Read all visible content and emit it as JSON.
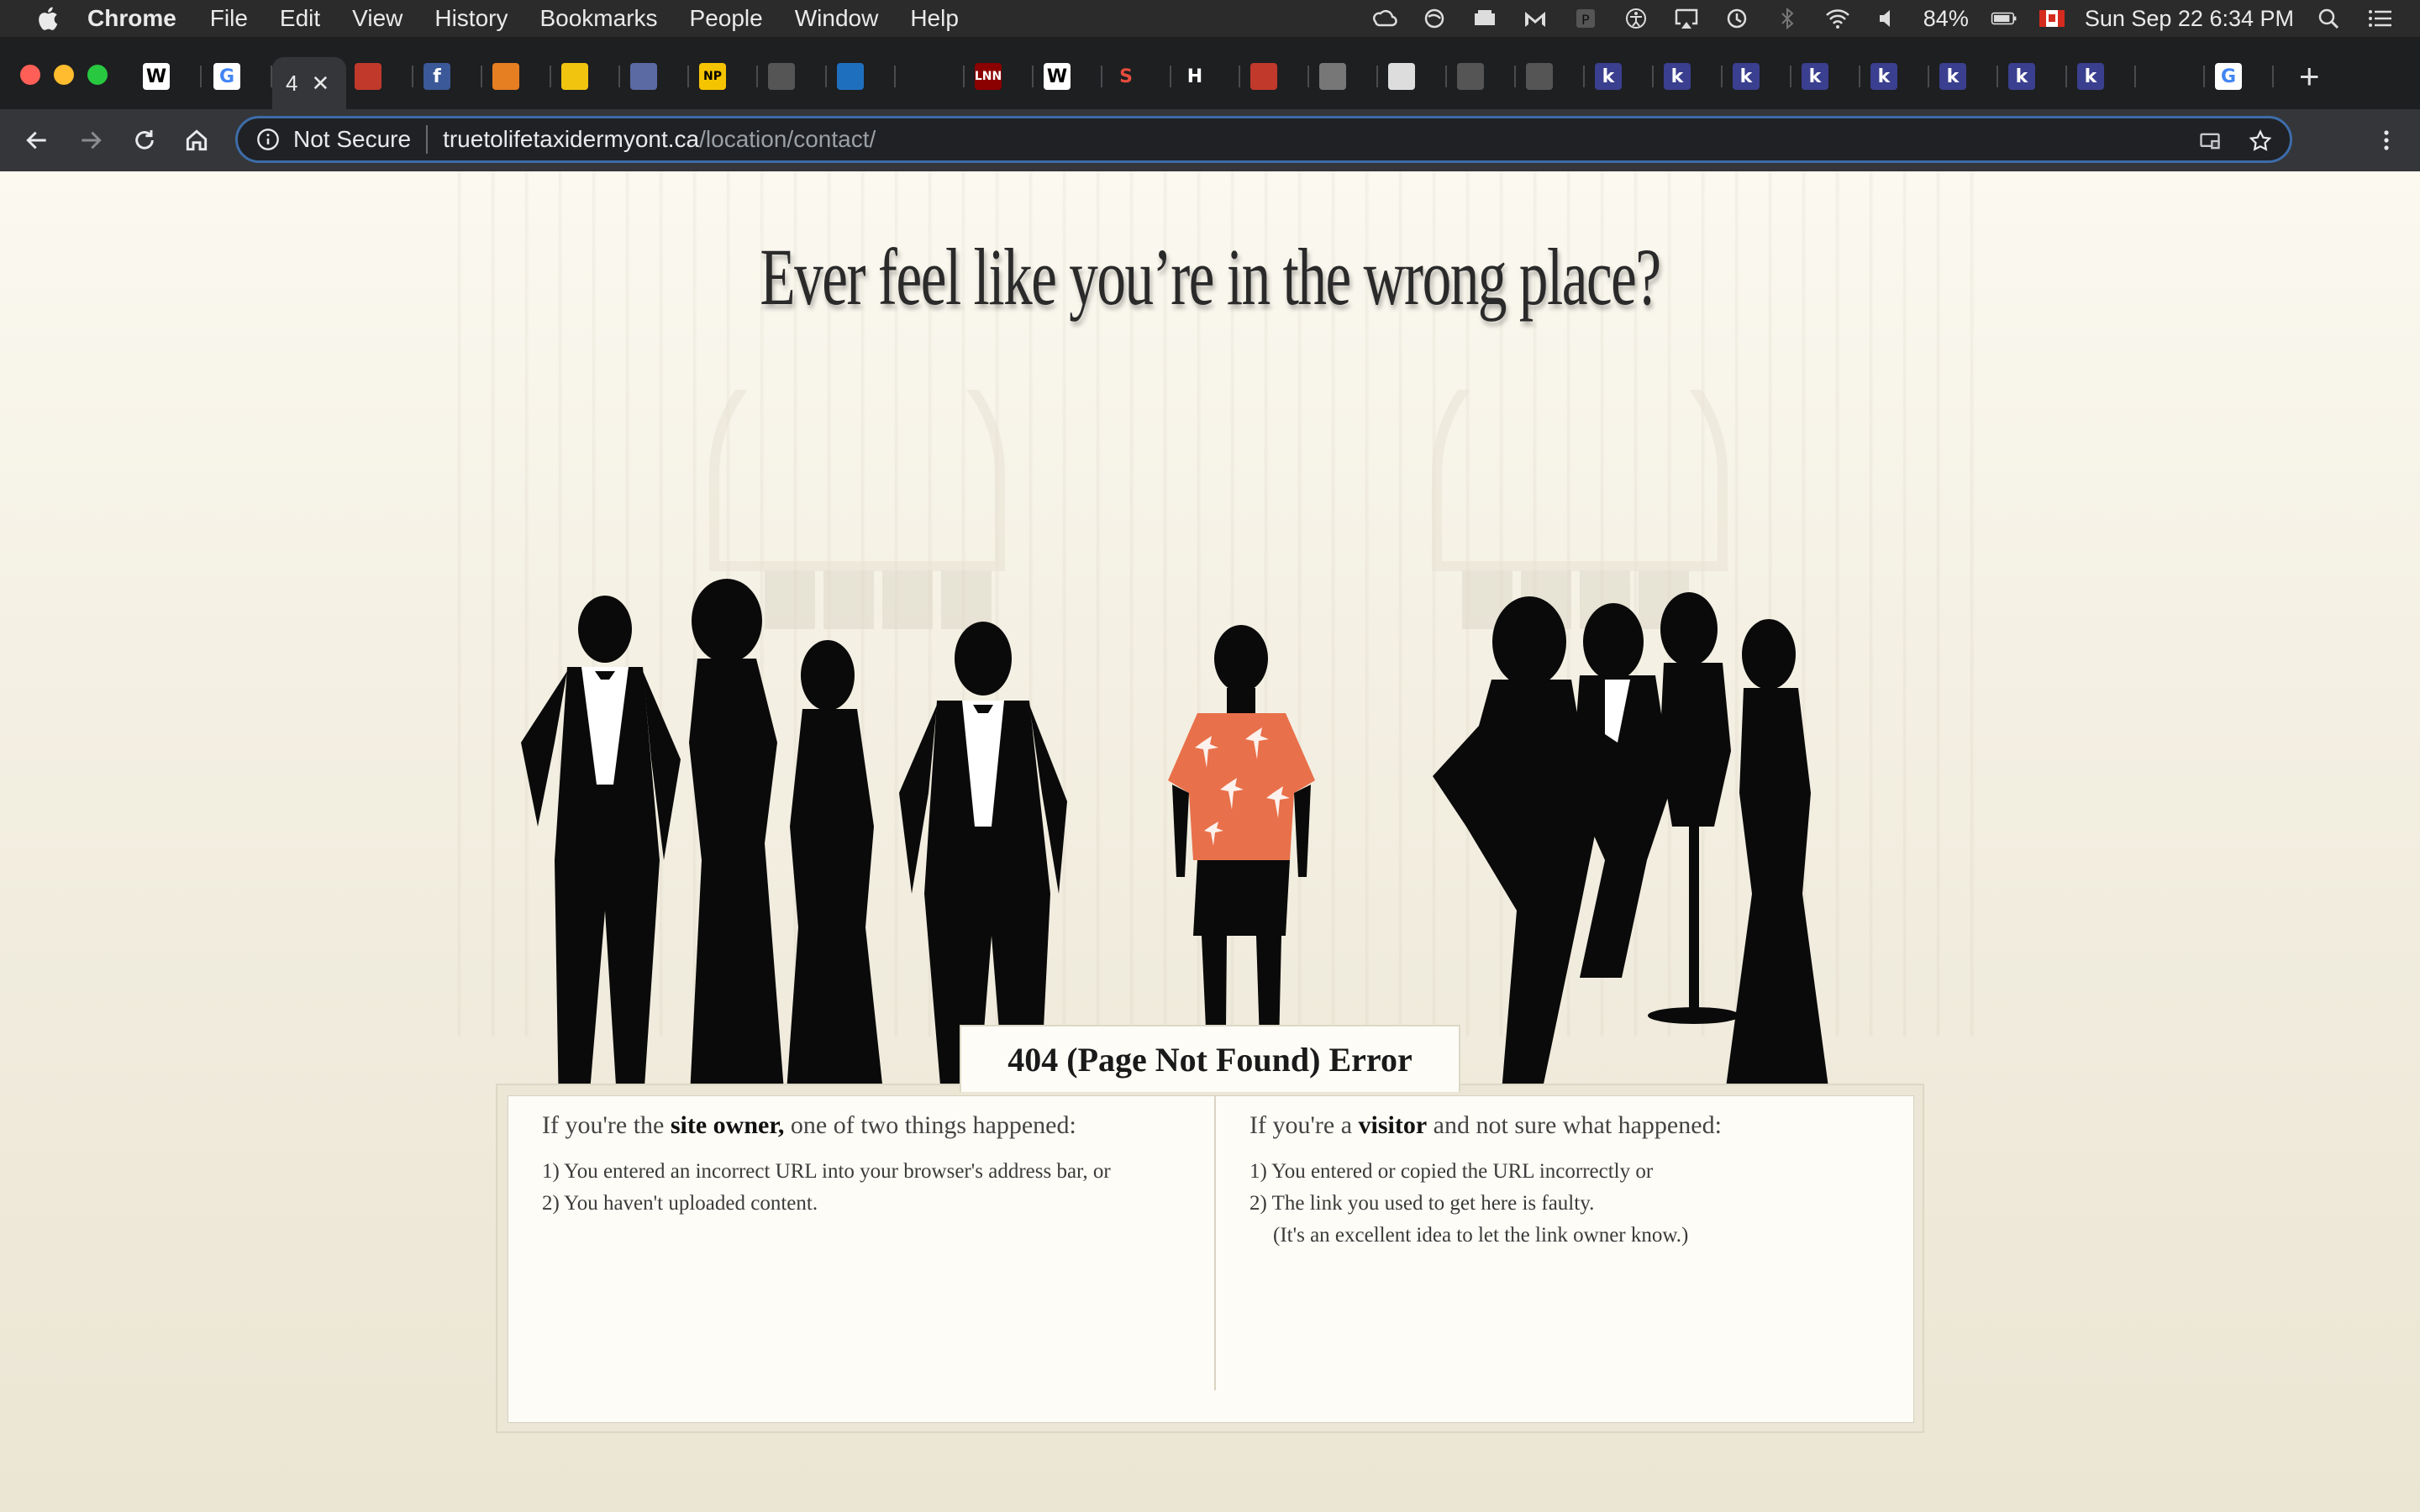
{
  "menubar": {
    "app_name": "Chrome",
    "items": [
      "File",
      "Edit",
      "View",
      "History",
      "Bookmarks",
      "People",
      "Window",
      "Help"
    ],
    "battery": "84%",
    "clock": "Sun Sep 22  6:34 PM"
  },
  "tabs": {
    "active_label": "4",
    "favicons": [
      {
        "glyph": "W",
        "bg": "#ffffff",
        "fg": "#000000"
      },
      {
        "glyph": "G",
        "bg": "#ffffff",
        "fg": "#4285f4"
      },
      {
        "glyph": "",
        "bg": "#c0392b",
        "fg": "#ffffff"
      },
      {
        "glyph": "f",
        "bg": "#3b5998",
        "fg": "#ffffff"
      },
      {
        "glyph": "",
        "bg": "#e67e22",
        "fg": "#ffffff"
      },
      {
        "glyph": "",
        "bg": "#f1c40f",
        "fg": "#000000"
      },
      {
        "glyph": "",
        "bg": "#5b6aa3",
        "fg": "#ffffff"
      },
      {
        "glyph": "NP",
        "bg": "#f5c400",
        "fg": "#000000"
      },
      {
        "glyph": "",
        "bg": "#555555",
        "fg": "#ffffff"
      },
      {
        "glyph": "",
        "bg": "#1f6fbf",
        "fg": "#ffffff"
      },
      {
        "glyph": "",
        "bg": "#1e1f21",
        "fg": "#ffffff"
      },
      {
        "glyph": "LNN",
        "bg": "#8b0000",
        "fg": "#ffffff"
      },
      {
        "glyph": "W",
        "bg": "#ffffff",
        "fg": "#000000"
      },
      {
        "glyph": "S",
        "bg": "#1e1f21",
        "fg": "#e74c3c"
      },
      {
        "glyph": "H",
        "bg": "#1e1f21",
        "fg": "#ffffff"
      },
      {
        "glyph": "",
        "bg": "#c0392b",
        "fg": "#ffffff"
      },
      {
        "glyph": "",
        "bg": "#777777",
        "fg": "#ffffff"
      },
      {
        "glyph": "",
        "bg": "#dddddd",
        "fg": "#000000"
      },
      {
        "glyph": "",
        "bg": "#555555",
        "fg": "#ffffff"
      },
      {
        "glyph": "",
        "bg": "#555555",
        "fg": "#ffffff"
      },
      {
        "glyph": "k",
        "bg": "#3a3f8f",
        "fg": "#ffffff"
      },
      {
        "glyph": "k",
        "bg": "#3a3f8f",
        "fg": "#ffffff"
      },
      {
        "glyph": "k",
        "bg": "#3a3f8f",
        "fg": "#ffffff"
      },
      {
        "glyph": "k",
        "bg": "#3a3f8f",
        "fg": "#ffffff"
      },
      {
        "glyph": "k",
        "bg": "#3a3f8f",
        "fg": "#ffffff"
      },
      {
        "glyph": "k",
        "bg": "#3a3f8f",
        "fg": "#ffffff"
      },
      {
        "glyph": "k",
        "bg": "#3a3f8f",
        "fg": "#ffffff"
      },
      {
        "glyph": "k",
        "bg": "#3a3f8f",
        "fg": "#ffffff"
      },
      {
        "glyph": "",
        "bg": "#1e1f21",
        "fg": "#d52b1e"
      },
      {
        "glyph": "G",
        "bg": "#ffffff",
        "fg": "#4285f4"
      }
    ]
  },
  "omnibox": {
    "security_label": "Not Secure",
    "url_host": "truetolifetaxidermyont.ca",
    "url_path": "/location/contact/"
  },
  "page": {
    "headline": "Ever feel like you’re in the wrong place?",
    "error_title": "404 (Page Not Found) Error",
    "owner": {
      "lead_pre": "If you're the ",
      "lead_bold": "site owner,",
      "lead_post": " one of two things happened:",
      "lines": [
        "1) You entered an incorrect URL into your browser's address bar, or",
        "2) You haven't uploaded content."
      ]
    },
    "visitor": {
      "lead_pre": "If you're a ",
      "lead_bold": "visitor",
      "lead_post": " and not sure what happened:",
      "lines": [
        "1) You entered or copied the URL incorrectly or",
        "2) The link you used to get here is faulty.",
        "(It's an excellent idea to let the link owner know.)"
      ]
    }
  },
  "colors": {
    "shirt": "#e8704a",
    "silhouette": "#0a0a0a"
  }
}
